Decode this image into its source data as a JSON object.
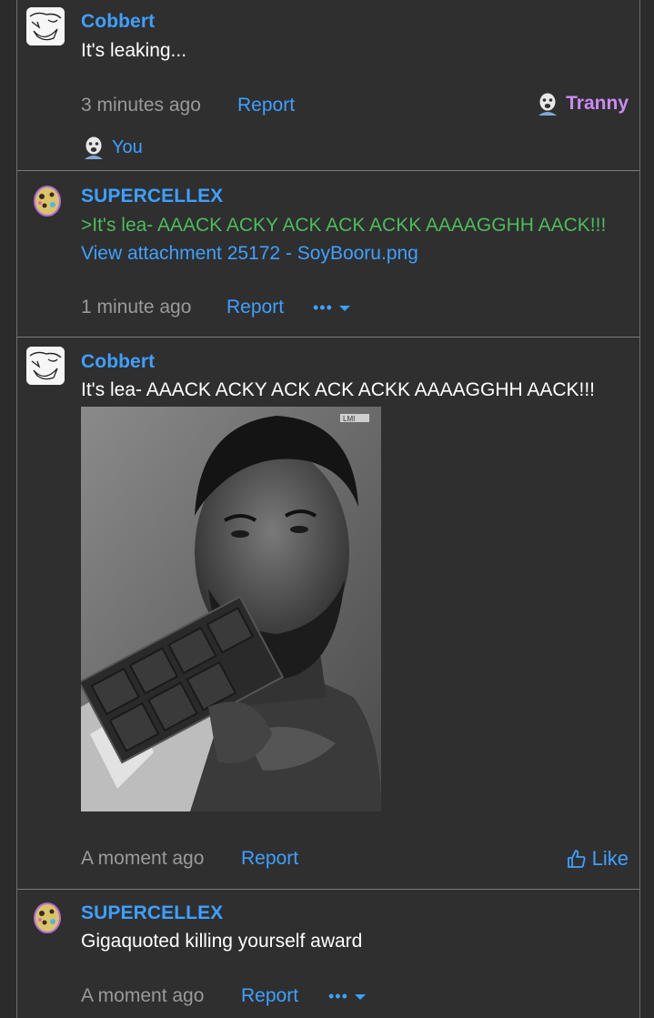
{
  "posts": [
    {
      "username": "Cobbert",
      "message": "It's leaking...",
      "time": "3 minutes ago",
      "report": "Report",
      "reaction_right": {
        "icon": "soyjak-face-icon",
        "label": "Tranny",
        "color": "#c98cf0"
      },
      "reaction_left": {
        "icon": "soyjak-face-icon",
        "label": "You",
        "color": "#3fa0ff"
      }
    },
    {
      "username": "SUPERCELLEX",
      "message": ">It's lea- AAACK ACKY ACK ACK ACKK AAAAGGHH AACK!!!",
      "attachment_link": "View attachment 25172 - SoyBooru.png",
      "time": "1 minute ago",
      "report": "Report",
      "more": "•••"
    },
    {
      "username": "Cobbert",
      "message": "It's lea- AAACK ACKY ACK ACK ACKK AAAAGGHH AACK!!!",
      "image_watermark": "LMI",
      "time": "A moment ago",
      "report": "Report",
      "like": "Like"
    },
    {
      "username": "SUPERCELLEX",
      "message": "Gigaquoted killing yourself award",
      "time": "A moment ago",
      "report": "Report",
      "more": "•••"
    }
  ],
  "colors": {
    "background": "#2f2f2f",
    "link": "#3fa0ff",
    "quote_green": "#4cbc5c",
    "muted": "#9a9a9a",
    "tranny_purple": "#c98cf0"
  }
}
